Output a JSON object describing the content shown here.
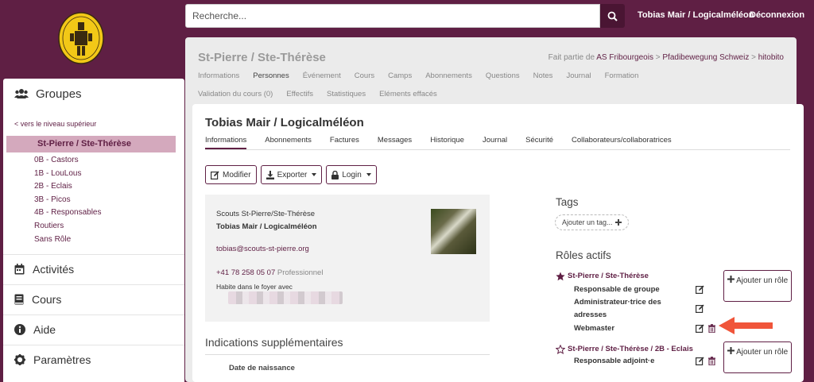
{
  "search": {
    "placeholder": "Recherche..."
  },
  "header": {
    "user": "Tobias Mair / Logicalméléon",
    "logout": "Déconnexion"
  },
  "sidebar": {
    "groups_label": "Groupes",
    "back_link": "< vers le niveau supérieur",
    "current": "St-Pierre / Ste-Thérèse",
    "subgroups": [
      "0B - Castors",
      "1B - LouLous",
      "2B - Eclais",
      "3B - Picos",
      "4B - Responsables",
      "Routiers",
      "Sans Rôle"
    ],
    "sections": [
      "Activités",
      "Cours",
      "Aide",
      "Paramètres"
    ]
  },
  "group": {
    "title": "St-Pierre / Ste-Thérèse",
    "breadcrumb_prefix": "Fait partie de",
    "breadcrumb": [
      "AS Fribourgeois",
      "Pfadibewegung Schweiz",
      "hitobito"
    ],
    "breadcrumb_sep": ">",
    "tabs_row1": [
      "Informations",
      "Personnes",
      "Événement",
      "Cours",
      "Camps",
      "Abonnements",
      "Questions",
      "Notes",
      "Journal",
      "Formation"
    ],
    "tabs_row2": [
      "Validation du cours (0)",
      "Effectifs",
      "Statistiques",
      "Eléments effacés"
    ]
  },
  "person": {
    "title": "Tobias Mair / Logicalméléon",
    "tabs": [
      "Informations",
      "Abonnements",
      "Factures",
      "Messages",
      "Historique",
      "Journal",
      "Sécurité",
      "Collaborateurs/collaboratrices"
    ],
    "actions": {
      "edit": "Modifier",
      "export": "Exporter",
      "login": "Login"
    },
    "contact": {
      "org": "Scouts St-Pierre/Ste-Thérèse",
      "name": "Tobias Mair / Logicalméléon",
      "email": "tobias@scouts-st-pierre.org",
      "phone": "+41 78 258 05 07",
      "phone_type": "Professionnel",
      "household": "Habite dans le foyer avec"
    },
    "extra_title": "Indications supplémentaires",
    "birth_label": "Date de naissance",
    "tags_title": "Tags",
    "tag_add": "Ajouter un tag...",
    "roles_title": "Rôles actifs",
    "roles": [
      {
        "group": "St-Pierre / Ste-Thérèse",
        "primary": true,
        "roles": [
          "Responsable de groupe",
          "Administrateur·trice des adresses",
          "Webmaster"
        ]
      },
      {
        "group": "St-Pierre / Ste-Thérèse / 2B - Eclais",
        "primary": false,
        "roles": [
          "Responsable adjoint·e"
        ]
      }
    ],
    "add_role_label": "Ajouter un rôle"
  },
  "colors": {
    "brand": "#5f1f44",
    "highlight": "#d4a9bd",
    "arrow": "#f0553a"
  }
}
